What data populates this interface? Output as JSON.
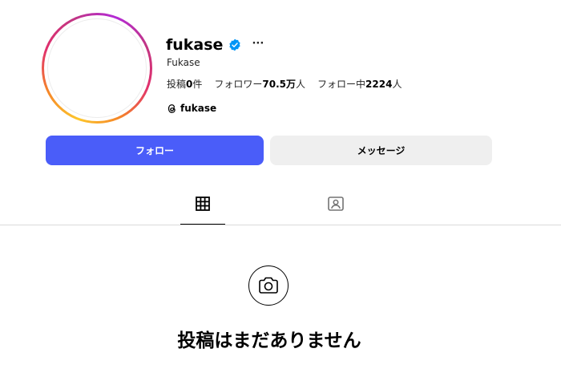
{
  "profile": {
    "username": "fukase",
    "full_name": "Fukase",
    "more_label": "···",
    "verified_color": "#0095f6",
    "ring_colors": [
      "#fdc62b",
      "#f58529",
      "#e1306c",
      "#c13584",
      "#b32ad6"
    ]
  },
  "stats": {
    "posts_prefix": "投稿",
    "posts_value": "0",
    "posts_suffix": "件",
    "followers_prefix": "フォロワー",
    "followers_value": "70.5万",
    "followers_suffix": "人",
    "following_prefix": "フォロー中",
    "following_value": "2224",
    "following_suffix": "人"
  },
  "threads": {
    "handle": "fukase",
    "icon": "threads-icon"
  },
  "buttons": {
    "follow_label": "フォロー",
    "follow_color": "#4a5df9",
    "message_label": "メッセージ"
  },
  "tabs": [
    {
      "icon": "grid-icon",
      "active": true
    },
    {
      "icon": "tagged-icon",
      "active": false
    }
  ],
  "empty_state": {
    "icon": "camera-icon",
    "text": "投稿はまだありません"
  }
}
